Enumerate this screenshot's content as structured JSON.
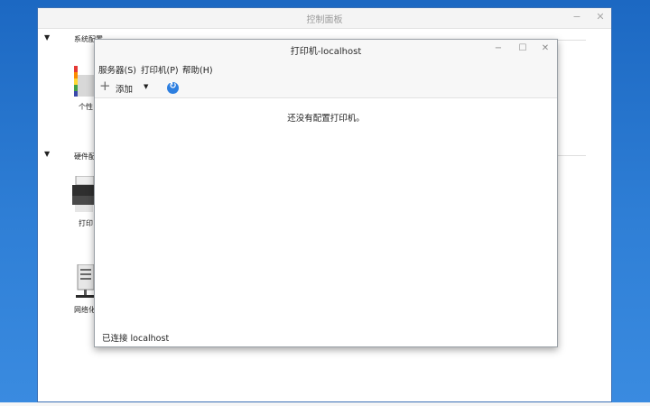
{
  "control_panel": {
    "title": "控制面板",
    "controls": {
      "minimize": "−",
      "close": "✕"
    },
    "sections": [
      {
        "title": "系统配置",
        "items": [
          {
            "label": "个性",
            "icon": "appearance-palette-icon"
          }
        ]
      },
      {
        "title": "硬件配",
        "items": [
          {
            "label": "打印",
            "icon": "printer-icon"
          },
          {
            "label": "网络化",
            "icon": "network-computer-icon"
          }
        ]
      }
    ],
    "section_arrow": "▼"
  },
  "printer_window": {
    "title": "打印机-localhost",
    "controls": {
      "minimize": "−",
      "maximize": "☐",
      "close": "✕"
    },
    "menu": {
      "server": "服务器(S)",
      "printer": "打印机(P)",
      "help": "帮助(H)"
    },
    "toolbar": {
      "add_label": "添加",
      "add_icon": "+",
      "dropdown_icon": "▼",
      "refresh_icon": "↻"
    },
    "empty_message": "还没有配置打印机。",
    "status": "已连接 localhost"
  },
  "colors": {
    "desktop_blue": "#2f7fd6",
    "refresh_blue": "#2d7fe0"
  }
}
